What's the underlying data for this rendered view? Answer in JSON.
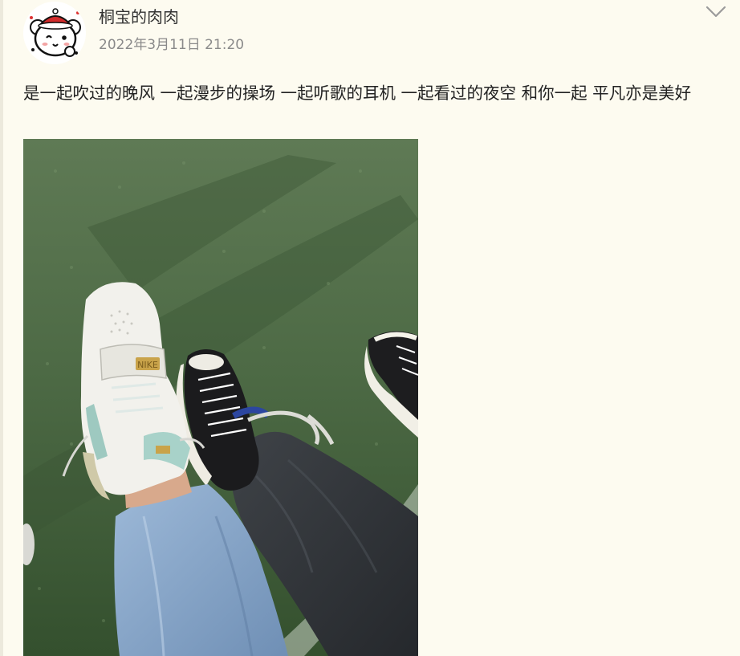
{
  "post": {
    "author": {
      "name": "桐宝的肉肉",
      "avatar_icon": "cartoon-bear-avatar-icon"
    },
    "timestamp": "2022年3月11日 21:20",
    "more_icon": "chevron-down-icon",
    "text": "是一起吹过的晚风 一起漫步的操场 一起听歌的耳机 一起看过的夜空 和你一起 平凡亦是美好",
    "image": {
      "brand_text": "NIKE",
      "icon": "sneakers-on-grass-photo"
    }
  },
  "colors": {
    "background": "#fdfbf0",
    "text": "#222222",
    "secondary_text": "#8a8a8a"
  }
}
